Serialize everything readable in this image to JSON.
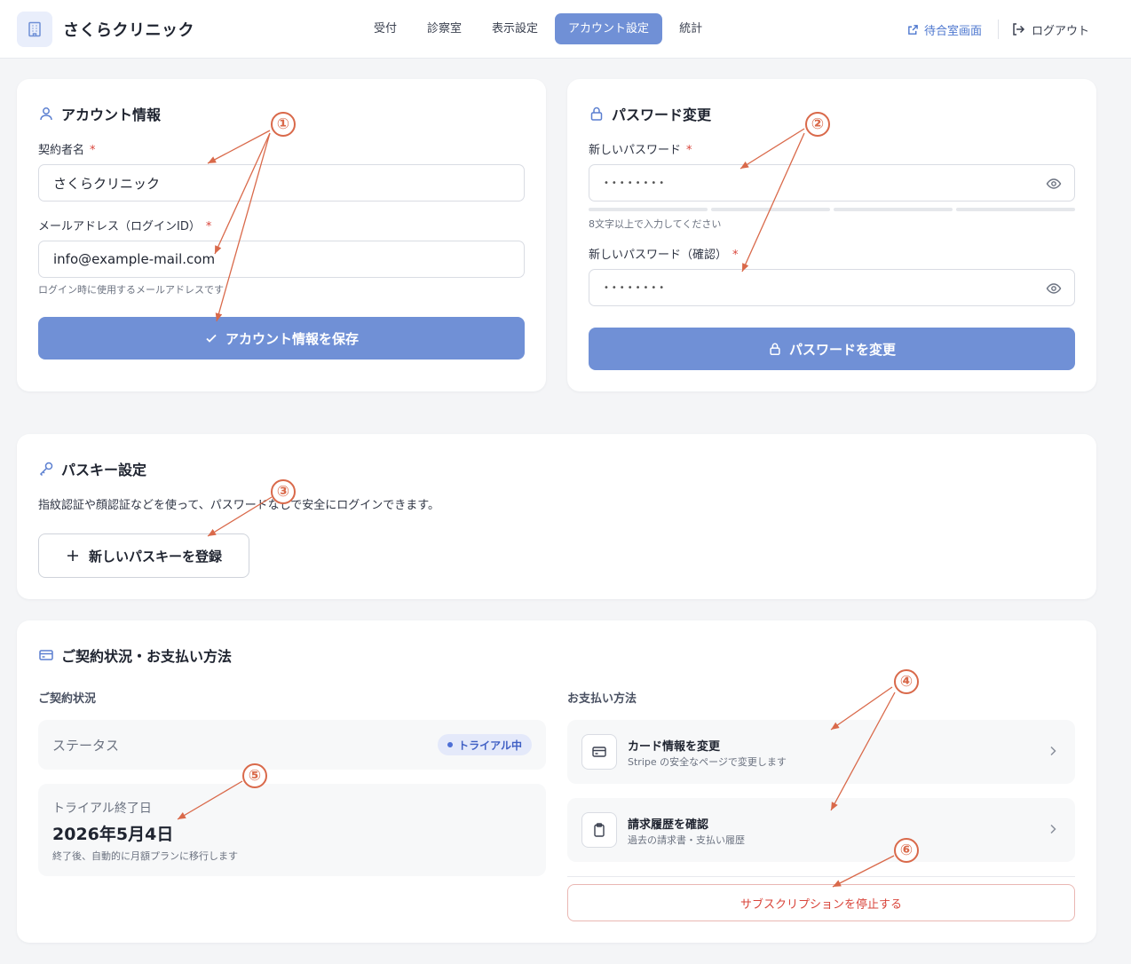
{
  "header": {
    "brand": "さくらクリニック",
    "nav": [
      {
        "label": "受付",
        "active": false
      },
      {
        "label": "診察室",
        "active": false
      },
      {
        "label": "表示設定",
        "active": false
      },
      {
        "label": "アカウント設定",
        "active": true
      },
      {
        "label": "統計",
        "active": false
      }
    ],
    "waiting_room": "待合室画面",
    "logout": "ログアウト"
  },
  "account": {
    "title": "アカウント情報",
    "name_label": "契約者名",
    "required_mark": "*",
    "name_value": "さくらクリニック",
    "email_label": "メールアドレス（ログインID）",
    "email_value": "info@example-mail.com",
    "email_help": "ログイン時に使用するメールアドレスです",
    "save_button": "アカウント情報を保存"
  },
  "password": {
    "title": "パスワード変更",
    "new_label": "新しいパスワード",
    "new_value": "••••••••",
    "help": "8文字以上で入力してください",
    "confirm_label": "新しいパスワード（確認）",
    "confirm_value": "••••••••",
    "change_button": "パスワードを変更"
  },
  "passkey": {
    "title": "パスキー設定",
    "description": "指紋認証や顔認証などを使って、パスワードなしで安全にログインできます。",
    "register_button": "新しいパスキーを登録"
  },
  "contract": {
    "title": "ご契約状況・お支払い方法",
    "status_heading": "ご契約状況",
    "status_label": "ステータス",
    "status_badge": "トライアル中",
    "trial_end_label": "トライアル終了日",
    "trial_end_date": "2026年5月4日",
    "trial_note": "終了後、自動的に月額プランに移行します",
    "payment_heading": "お支払い方法",
    "card_title": "カード情報を変更",
    "card_sub": "Stripe の安全なページで変更します",
    "billing_title": "請求履歴を確認",
    "billing_sub": "過去の請求書・支払い履歴",
    "cancel_button": "サブスクリプションを停止する"
  },
  "annotations": [
    "①",
    "②",
    "③",
    "④",
    "⑤",
    "⑥"
  ],
  "colors": {
    "accent": "#7090d6",
    "link": "#4d77cf",
    "required": "#d9453b",
    "annotation": "#d9694a",
    "badge_bg": "#e4e9fa",
    "badge_text": "#3f5fc4"
  }
}
